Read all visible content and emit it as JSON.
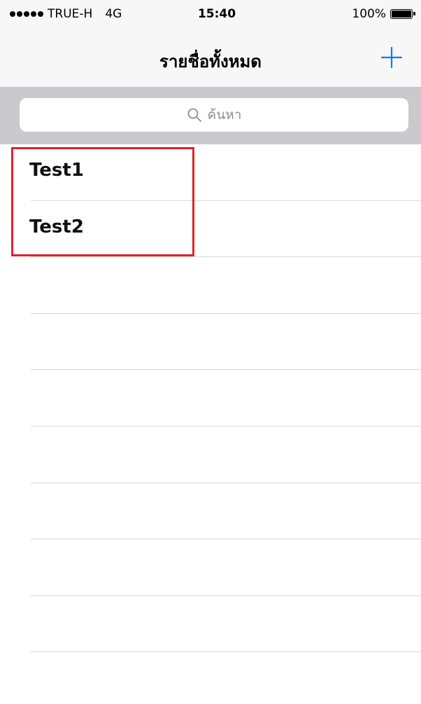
{
  "status_bar": {
    "carrier": "TRUE-H",
    "network": "4G",
    "time": "15:40",
    "battery": "100%",
    "battery_level": 1.0
  },
  "nav_bar": {
    "title": "รายชื่อทั้งหมด",
    "add_icon": "plus-icon",
    "accent_color": "#007aff"
  },
  "search": {
    "placeholder": "ค้นหา",
    "icon": "search-icon"
  },
  "list": {
    "items": [
      {
        "label": "Test1"
      },
      {
        "label": "Test2"
      }
    ],
    "empty_rows": 7
  },
  "annotation": {
    "highlight_color": "#e0232b"
  }
}
